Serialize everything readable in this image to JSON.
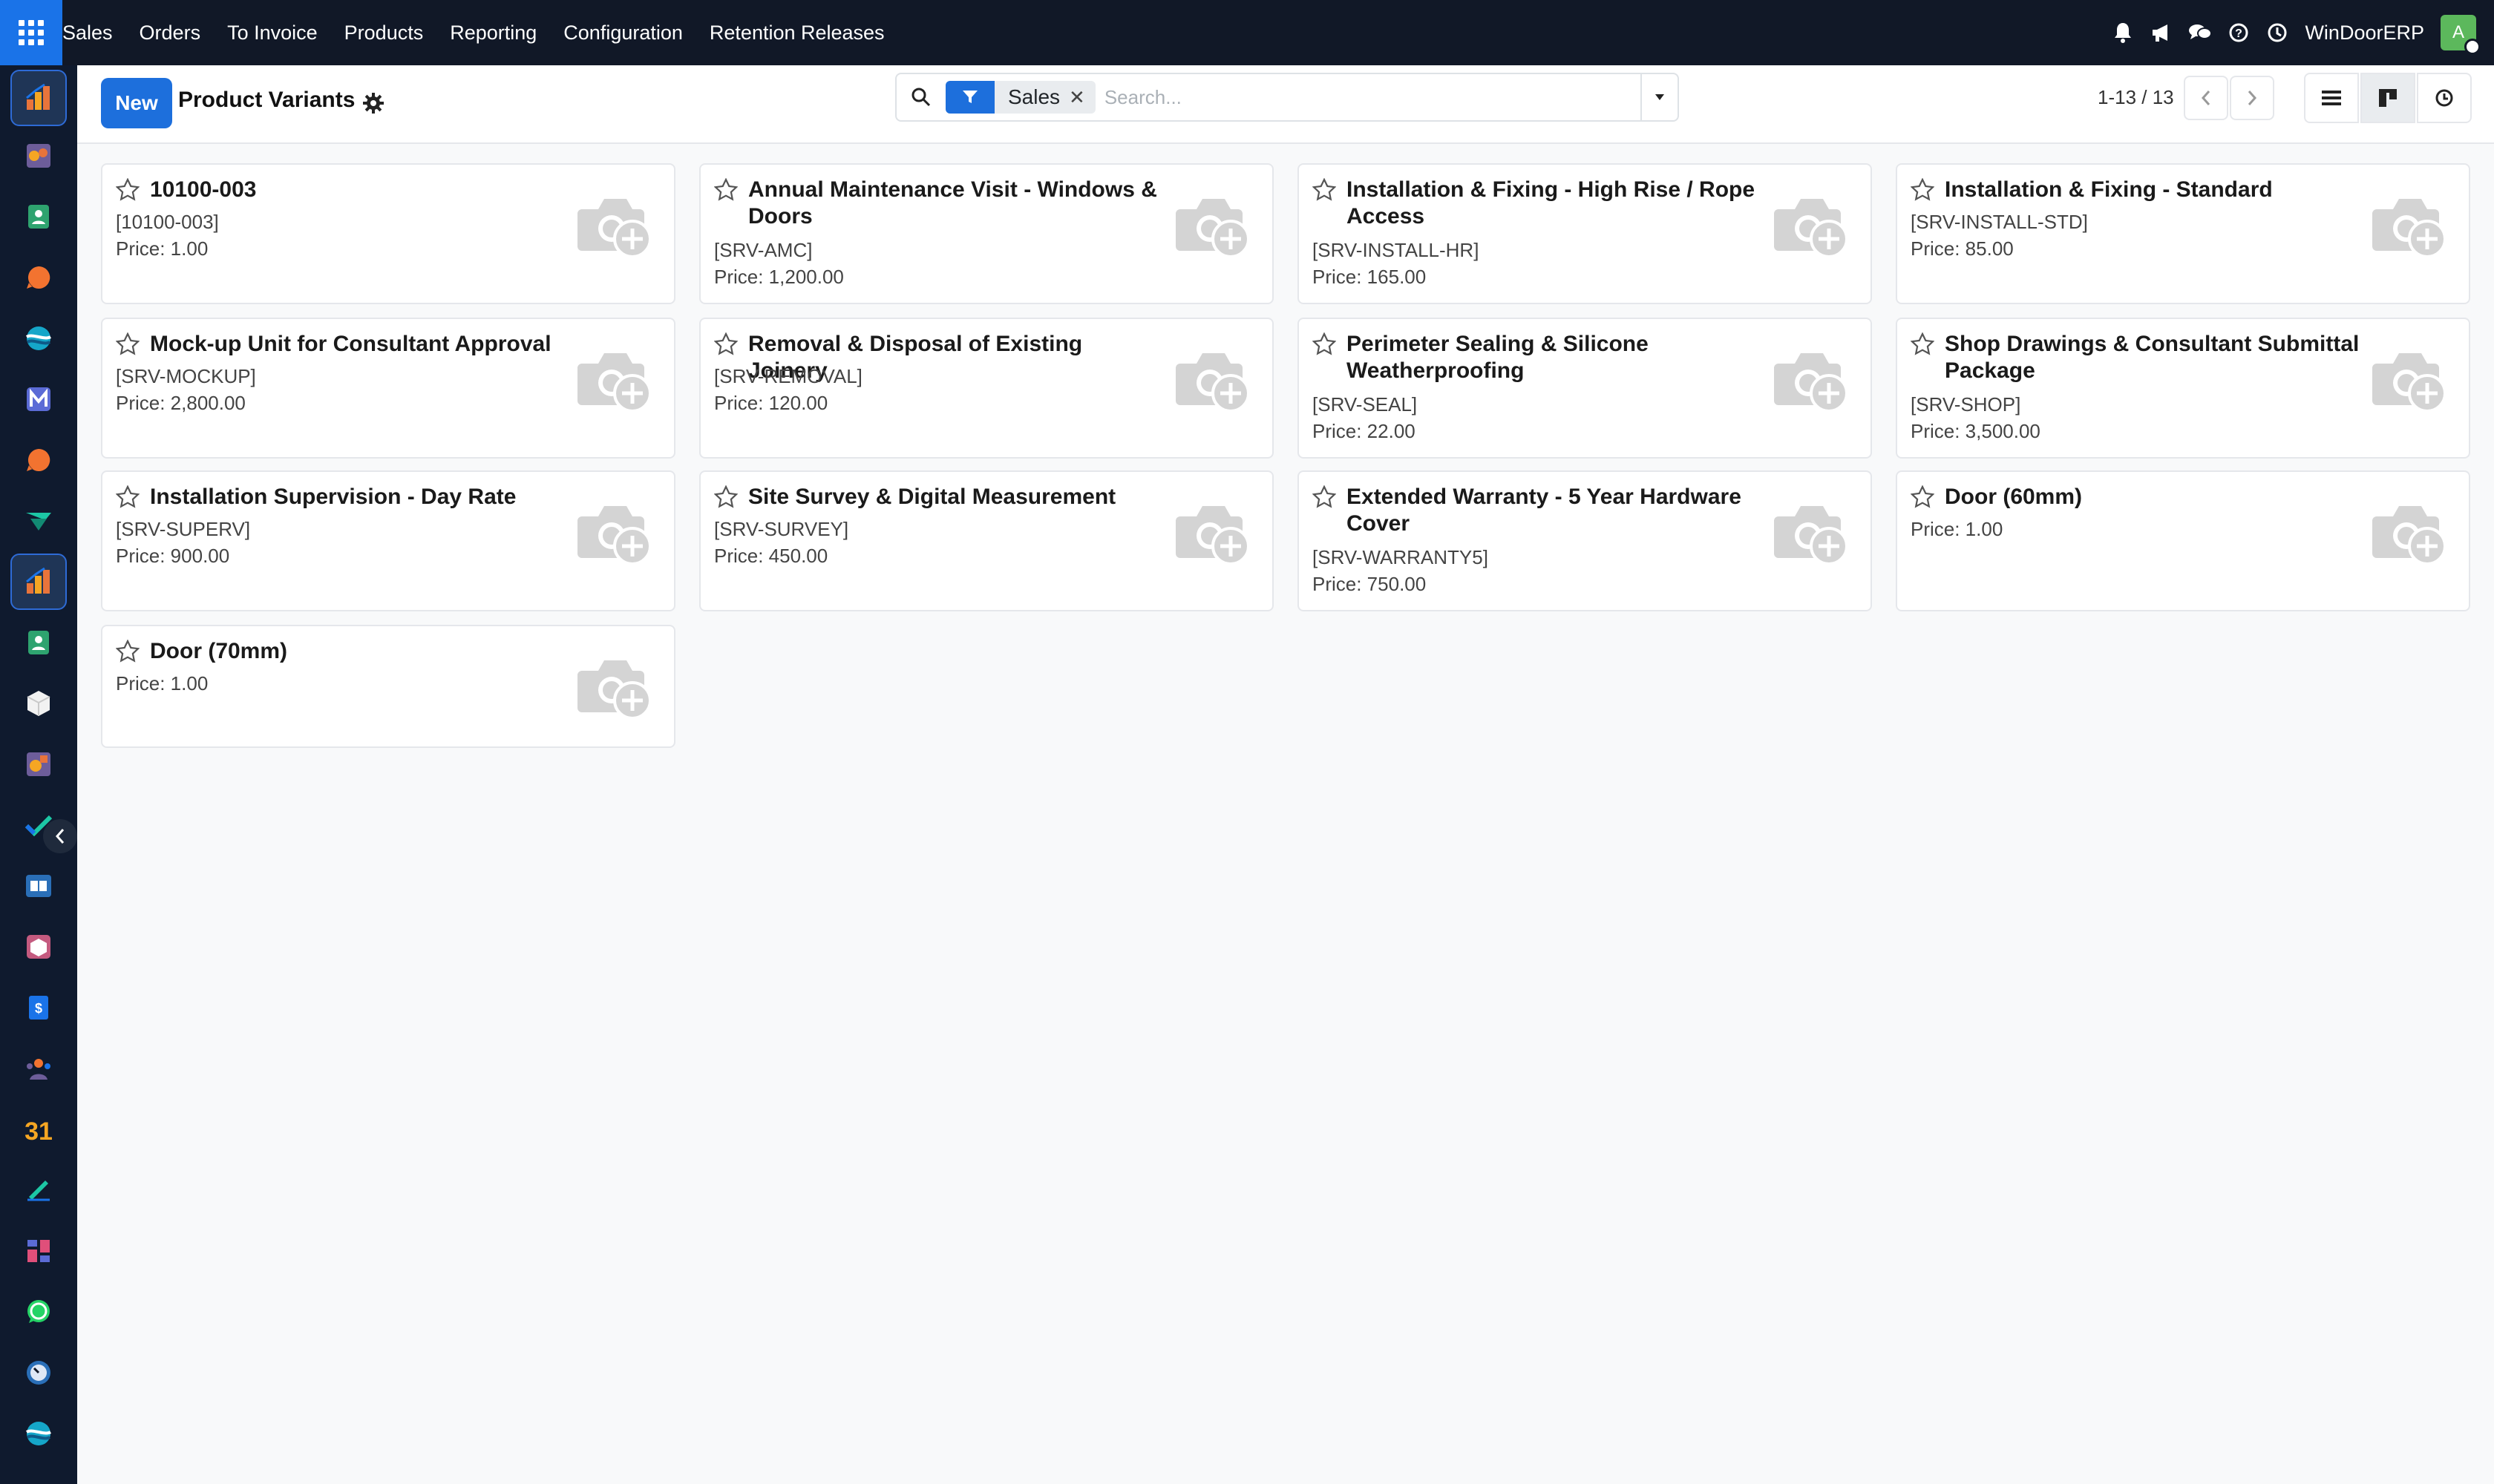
{
  "topbar": {
    "menu": [
      "Sales",
      "Orders",
      "To Invoice",
      "Products",
      "Reporting",
      "Configuration",
      "Retention Releases"
    ],
    "company": "WinDoorERP",
    "avatar_initial": "A",
    "icons": [
      "bell-icon",
      "megaphone-icon",
      "chat-icon",
      "help-icon",
      "clock-icon"
    ]
  },
  "sidebar": {
    "apps": [
      "sales",
      "discuss",
      "contacts",
      "livechat",
      "website",
      "email-marketing",
      "chat",
      "project",
      "sales-active",
      "contacts-2",
      "inventory",
      "crm",
      "todo",
      "knowledge",
      "product",
      "accounting",
      "employees",
      "calendar",
      "sign",
      "dashboards",
      "whatsapp",
      "timesheets",
      "website-2"
    ]
  },
  "control": {
    "new_label": "New",
    "title": "Product Variants",
    "facet_value": "Sales",
    "search_placeholder": "Search...",
    "pager": "1-13 / 13"
  },
  "cards": [
    {
      "name": "10100-003",
      "ref": "[10100-003]",
      "price": "Price: 1.00"
    },
    {
      "name": "Annual Maintenance Visit - Windows & Doors",
      "ref": "[SRV-AMC]",
      "price": "Price: 1,200.00"
    },
    {
      "name": "Installation & Fixing - High Rise / Rope Access",
      "ref": "[SRV-INSTALL-HR]",
      "price": "Price: 165.00"
    },
    {
      "name": "Installation & Fixing - Standard",
      "ref": "[SRV-INSTALL-STD]",
      "price": "Price: 85.00"
    },
    {
      "name": "Mock-up Unit for Consultant Approval",
      "ref": "[SRV-MOCKUP]",
      "price": "Price: 2,800.00"
    },
    {
      "name": "Removal & Disposal of Existing Joinery",
      "ref": "[SRV-REMOVAL]",
      "price": "Price: 120.00"
    },
    {
      "name": "Perimeter Sealing & Silicone Weatherproofing",
      "ref": "[SRV-SEAL]",
      "price": "Price: 22.00"
    },
    {
      "name": "Shop Drawings & Consultant Submittal Package",
      "ref": "[SRV-SHOP]",
      "price": "Price: 3,500.00"
    },
    {
      "name": "Installation Supervision - Day Rate",
      "ref": "[SRV-SUPERV]",
      "price": "Price: 900.00"
    },
    {
      "name": "Site Survey & Digital Measurement",
      "ref": "[SRV-SURVEY]",
      "price": "Price: 450.00"
    },
    {
      "name": "Extended Warranty - 5 Year Hardware Cover",
      "ref": "[SRV-WARRANTY5]",
      "price": "Price: 750.00"
    },
    {
      "name": "Door (60mm)",
      "ref": "",
      "price": "Price: 1.00"
    },
    {
      "name": "Door (70mm)",
      "ref": "",
      "price": "Price: 1.00"
    }
  ]
}
